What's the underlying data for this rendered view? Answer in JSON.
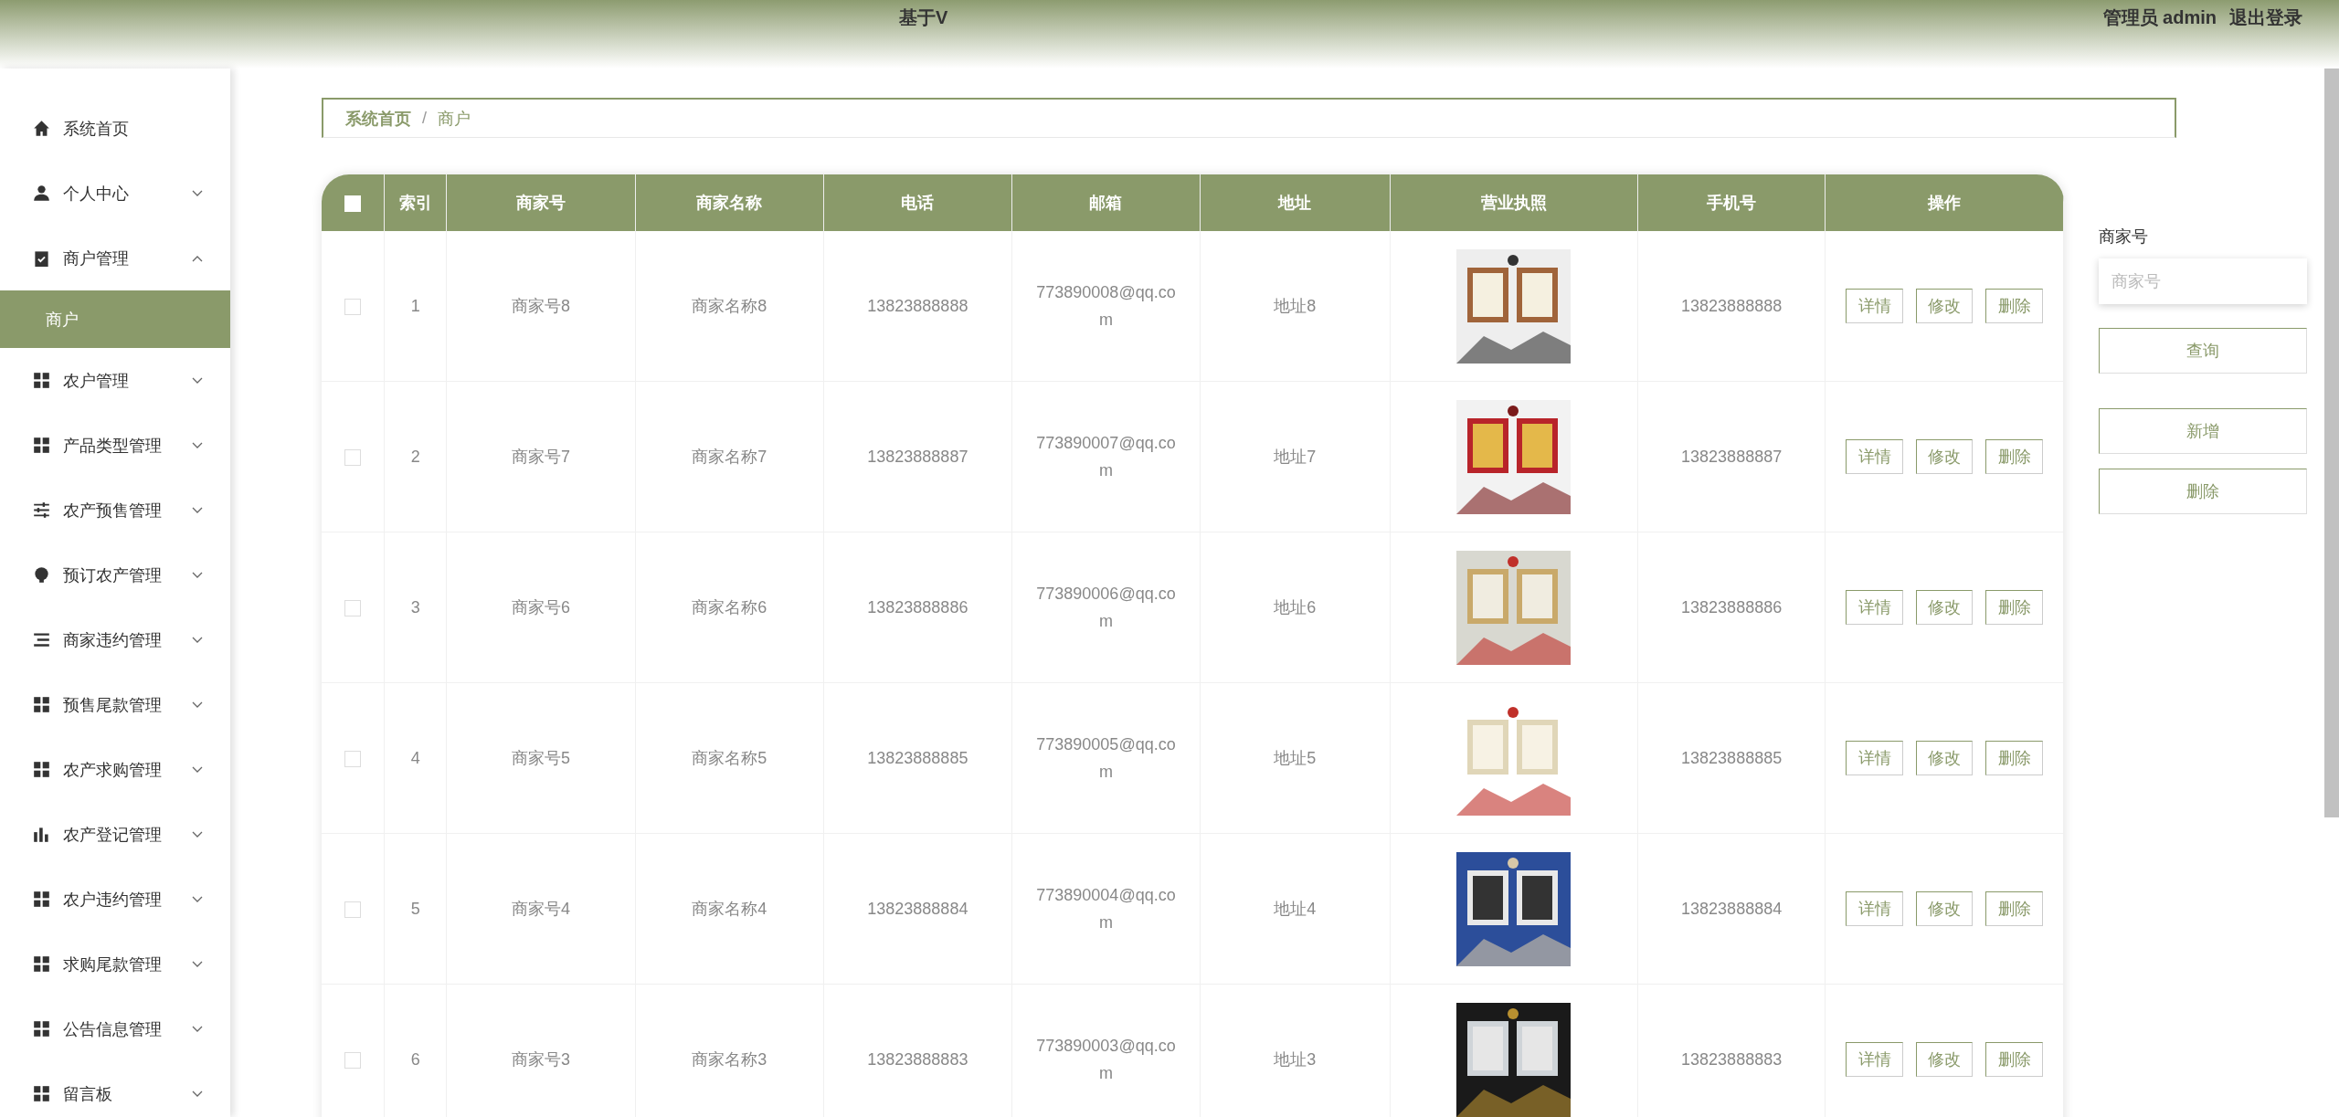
{
  "header": {
    "title": "基于V",
    "user": "管理员 admin",
    "logout": "退出登录"
  },
  "sidebar": {
    "items": [
      {
        "label": "系统首页"
      },
      {
        "label": "个人中心",
        "expanded": false
      },
      {
        "label": "商户管理",
        "expanded": true,
        "children": [
          {
            "label": "商户",
            "selected": true
          }
        ]
      },
      {
        "label": "农户管理",
        "expanded": false
      },
      {
        "label": "产品类型管理",
        "expanded": false
      },
      {
        "label": "农产预售管理",
        "expanded": false
      },
      {
        "label": "预订农产管理",
        "expanded": false
      },
      {
        "label": "商家违约管理",
        "expanded": false
      },
      {
        "label": "预售尾款管理",
        "expanded": false
      },
      {
        "label": "农产求购管理",
        "expanded": false
      },
      {
        "label": "农产登记管理",
        "expanded": false
      },
      {
        "label": "农户违约管理",
        "expanded": false
      },
      {
        "label": "求购尾款管理",
        "expanded": false
      },
      {
        "label": "公告信息管理",
        "expanded": false
      },
      {
        "label": "留言板",
        "expanded": false
      }
    ]
  },
  "breadcrumb": {
    "separator": "/",
    "items": [
      "系统首页",
      "商户"
    ]
  },
  "table": {
    "all_selected": false,
    "columns": [
      "索引",
      "商家号",
      "商家名称",
      "电话",
      "邮箱",
      "地址",
      "营业执照",
      "手机号",
      "操作"
    ],
    "rows": [
      {
        "selected": false,
        "cells": [
          "1",
          "商家号8",
          "商家名称8",
          "13823888888",
          "773890008@qq.com",
          "地址8"
        ],
        "mobile": "13823888888",
        "actions": [
          "详情",
          "修改",
          "删除"
        ]
      },
      {
        "selected": false,
        "cells": [
          "2",
          "商家号7",
          "商家名称7",
          "13823888887",
          "773890007@qq.com",
          "地址7"
        ],
        "mobile": "13823888887",
        "actions": [
          "详情",
          "修改",
          "删除"
        ]
      },
      {
        "selected": false,
        "cells": [
          "3",
          "商家号6",
          "商家名称6",
          "13823888886",
          "773890006@qq.com",
          "地址6"
        ],
        "mobile": "13823888886",
        "actions": [
          "详情",
          "修改",
          "删除"
        ]
      },
      {
        "selected": false,
        "cells": [
          "4",
          "商家号5",
          "商家名称5",
          "13823888885",
          "773890005@qq.com",
          "地址5"
        ],
        "mobile": "13823888885",
        "actions": [
          "详情",
          "修改",
          "删除"
        ]
      },
      {
        "selected": false,
        "cells": [
          "5",
          "商家号4",
          "商家名称4",
          "13823888884",
          "773890004@qq.com",
          "地址4"
        ],
        "mobile": "13823888884",
        "actions": [
          "详情",
          "修改",
          "删除"
        ]
      },
      {
        "selected": false,
        "cells": [
          "6",
          "商家号3",
          "商家名称3",
          "13823888883",
          "773890003@qq.com",
          "地址3"
        ],
        "mobile": "13823888883",
        "actions": [
          "详情",
          "修改",
          "删除"
        ]
      }
    ]
  },
  "search_panel": {
    "label": "商家号",
    "placeholder": "商家号",
    "query": "查询",
    "add": "新增",
    "delete": "删除"
  }
}
